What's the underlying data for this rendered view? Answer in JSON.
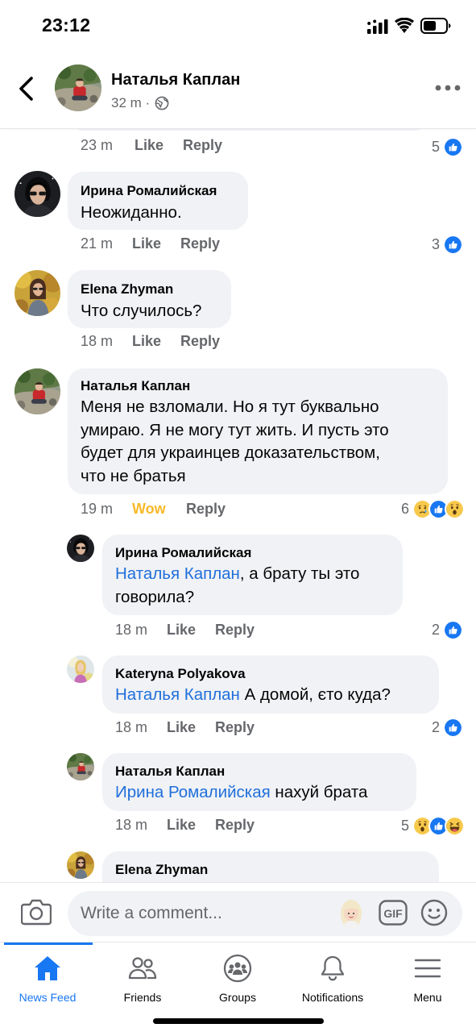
{
  "status_bar": {
    "time": "23:12"
  },
  "header": {
    "back_label": "Back",
    "author_name": "Наталья Каплан",
    "post_time": "32 m ·",
    "audience_icon": "globe-icon",
    "more_icon": "more-horizontal-icon"
  },
  "comments": [
    {
      "time": "23 m",
      "like_label": "Like",
      "reply_label": "Reply",
      "reactions": {
        "count": "5",
        "icons": [
          "like"
        ]
      }
    },
    {
      "author": "Ирина Ромалийская",
      "text": "Неожиданно.",
      "time": "21 m",
      "like_label": "Like",
      "reply_label": "Reply",
      "reactions": {
        "count": "3",
        "icons": [
          "like"
        ]
      }
    },
    {
      "author": "Elena Zhyman",
      "text": "Что случилось?",
      "time": "18 m",
      "like_label": "Like",
      "reply_label": "Reply"
    },
    {
      "author": "Наталья Каплан",
      "text_lines": [
        "Меня не взломали. Но я тут буквально",
        "умираю. Я не могу тут жить. И пусть это",
        "будет для украинцев доказательством,",
        "что не братья"
      ],
      "time": "19 m",
      "like_label": "Wow",
      "reply_label": "Reply",
      "reactions": {
        "count": "6",
        "icons": [
          "sad",
          "like",
          "wow"
        ]
      },
      "replies": [
        {
          "author": "Ирина Ромалийская",
          "mention": "Наталья Каплан",
          "text_after_mention": ", а брату ты это",
          "text_line2": "говорила?",
          "time": "18 m",
          "like_label": "Like",
          "reply_label": "Reply",
          "reactions": {
            "count": "2",
            "icons": [
              "like"
            ]
          }
        },
        {
          "author": "Kateryna Polyakova",
          "mention": "Наталья Каплан",
          "text_after_mention": " А домой, єто куда?",
          "time": "18 m",
          "like_label": "Like",
          "reply_label": "Reply",
          "reactions": {
            "count": "2",
            "icons": [
              "like"
            ]
          }
        },
        {
          "author": "Наталья Каплан",
          "mention": "Ирина Ромалийская",
          "text_after_mention": " нахуй брата",
          "time": "18 m",
          "like_label": "Like",
          "reply_label": "Reply",
          "reactions": {
            "count": "5",
            "icons": [
              "wow",
              "like",
              "haha"
            ]
          }
        },
        {
          "author": "Elena Zhyman"
        }
      ]
    }
  ],
  "composer": {
    "camera_icon": "camera-icon",
    "placeholder": "Write a comment...",
    "sticker_icon": "avatar-sticker-icon",
    "gif_label": "GIF",
    "emoji_icon": "emoji-icon"
  },
  "bottom_nav": {
    "items": [
      {
        "label": "News Feed",
        "icon": "home-icon",
        "active": true
      },
      {
        "label": "Friends",
        "icon": "friends-icon",
        "active": false
      },
      {
        "label": "Groups",
        "icon": "groups-icon",
        "active": false
      },
      {
        "label": "Notifications",
        "icon": "bell-icon",
        "active": false
      },
      {
        "label": "Menu",
        "icon": "menu-icon",
        "active": false
      }
    ]
  },
  "colors": {
    "brand_blue": "#1877f2",
    "mention_blue": "#216fdb",
    "wow_yellow": "#f7b928",
    "bubble_gray": "#f0f2f5",
    "meta_gray": "#65676b"
  }
}
